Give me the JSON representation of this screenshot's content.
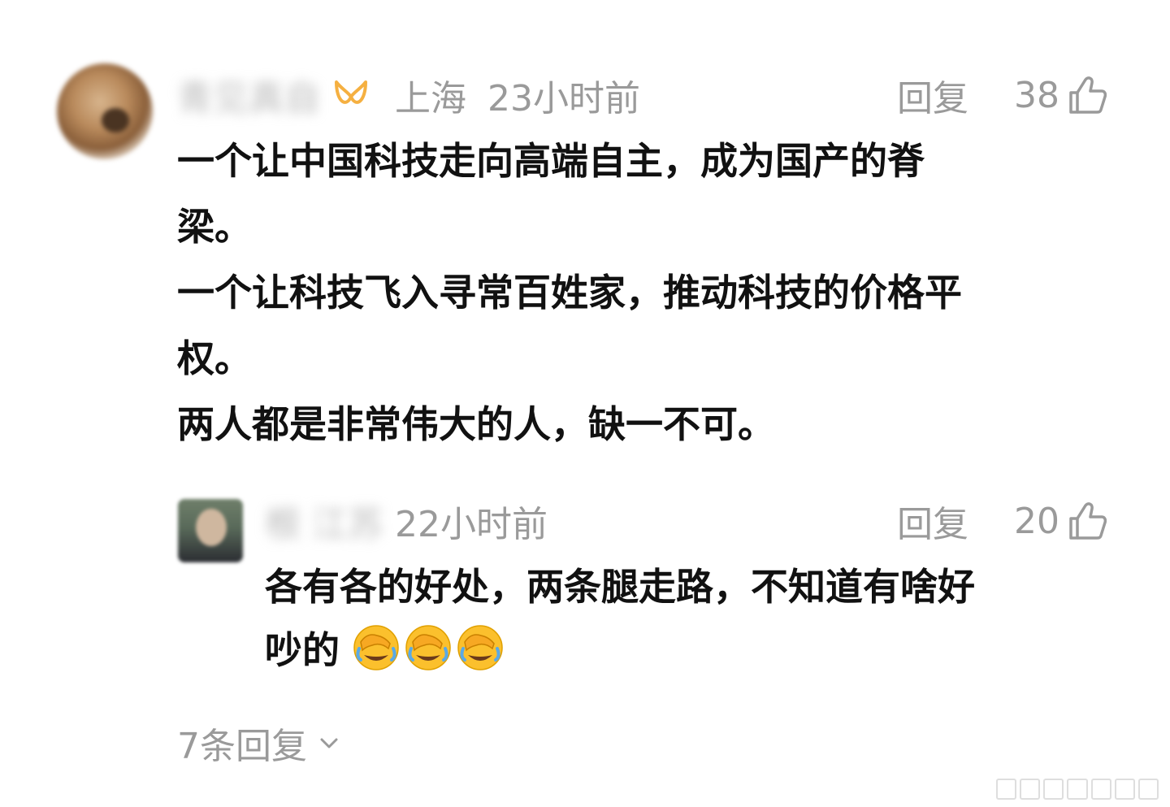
{
  "comment": {
    "author": "青见真自",
    "location": "上海",
    "time": "23小时前",
    "reply_label": "回复",
    "likes": "38",
    "lines": [
      "一个让中国科技走向高端自主，成为国产的脊",
      "梁。",
      "一个让科技飞入寻常百姓家，推动科技的价格平",
      "权。",
      "两人都是非常伟大的人，缺一不可。"
    ]
  },
  "reply": {
    "author": "根 江苏",
    "time": "22小时前",
    "reply_label": "回复",
    "likes": "20",
    "line1": "各有各的好处，两条腿走路，不知道有啥好",
    "line2": "吵的",
    "emoji_name": "facepalm-crying-laughing-emoji"
  },
  "more_replies": "7条回复",
  "colors": {
    "meta_gray": "#9a9a9a",
    "text": "#111111",
    "vip_badge": "#f5b041"
  }
}
